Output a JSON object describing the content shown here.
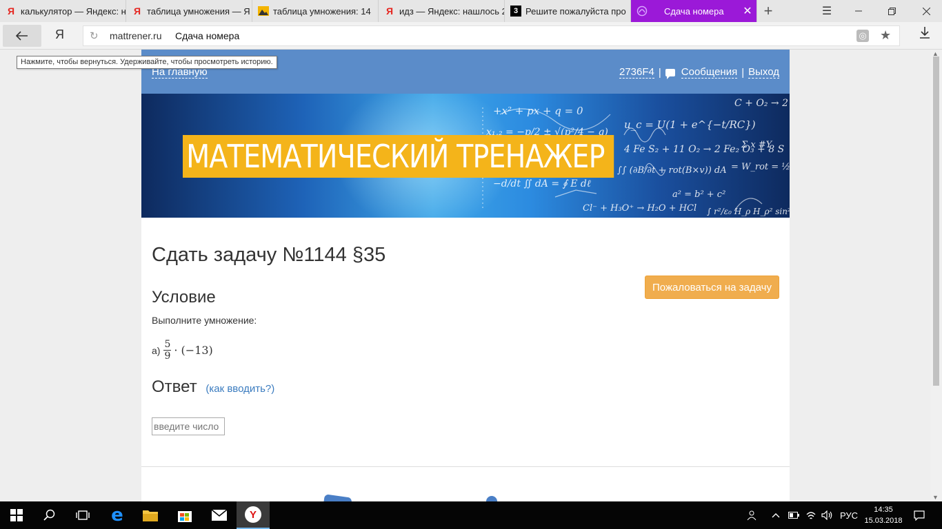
{
  "browser": {
    "tabs": [
      {
        "icon": "yandex-icon",
        "label": "калькулятор — Яндекс: н"
      },
      {
        "icon": "yandex-icon",
        "label": "таблица умножения — Я"
      },
      {
        "icon": "image-icon",
        "label": "таблица умножения: 14"
      },
      {
        "icon": "yandex-icon",
        "label": "идз — Яндекс: нашлось 2"
      },
      {
        "icon": "znanija-icon",
        "label": "Решите пожалуйста про"
      },
      {
        "icon": "mattrener-icon",
        "label": "Сдача номера"
      }
    ],
    "new_tab": "+",
    "domain": "mattrener.ru",
    "page_title": "Сдача номера",
    "yandex_logo": "Я",
    "back_tooltip": "Нажмите, чтобы вернуться. Удерживайте, чтобы просмотреть историю."
  },
  "header": {
    "home_link": "На главную",
    "user_id": "2736F4",
    "separator": "|",
    "messages": "Сообщения",
    "logout": "Выход"
  },
  "banner": {
    "title": "МАТЕМАТИЧЕСКИЙ ТРЕНАЖЕР"
  },
  "task": {
    "heading": "Сдать задачу №1144 §35",
    "complain_button": "Пожаловаться на задачу",
    "condition_heading": "Условие",
    "condition_text": "Выполните умножение:",
    "item_label": "а)",
    "numerator": "5",
    "denominator": "9",
    "expression_rest": "· (−13)",
    "answer_heading": "Ответ",
    "how_to_enter": "(как вводить?)",
    "answer_placeholder": "введите число"
  },
  "taskbar": {
    "language": "РУС",
    "time": "14:35",
    "date": "15.03.2018"
  },
  "colors": {
    "tab_active": "#9b19d8",
    "header_blue": "#5b8cc9",
    "banner_title_bg": "#f4b41a",
    "complain_button": "#f0ad4e",
    "link": "#3a7bbf"
  }
}
